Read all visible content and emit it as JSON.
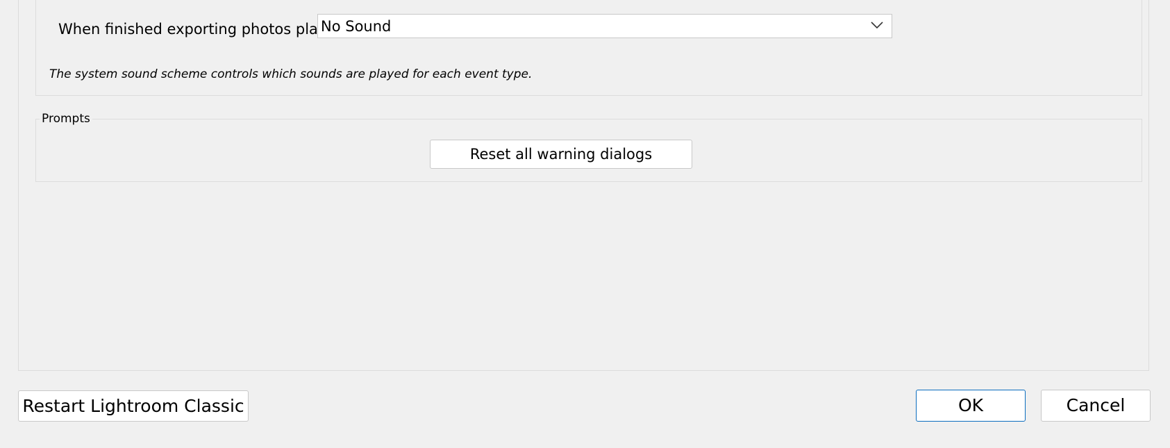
{
  "sounds": {
    "export_label": "When finished exporting photos play:",
    "export_sound_value": "No Sound",
    "hint": "The system sound scheme controls which sounds are played for each event type."
  },
  "prompts": {
    "title": "Prompts",
    "reset_label": "Reset all warning dialogs"
  },
  "footer": {
    "restart_label": "Restart Lightroom Classic",
    "ok_label": "OK",
    "cancel_label": "Cancel"
  },
  "icons": {
    "dropdown": "chevron-down-icon"
  },
  "colors": {
    "background": "#f0f0f0",
    "default_button_border": "#0b6dbf"
  }
}
